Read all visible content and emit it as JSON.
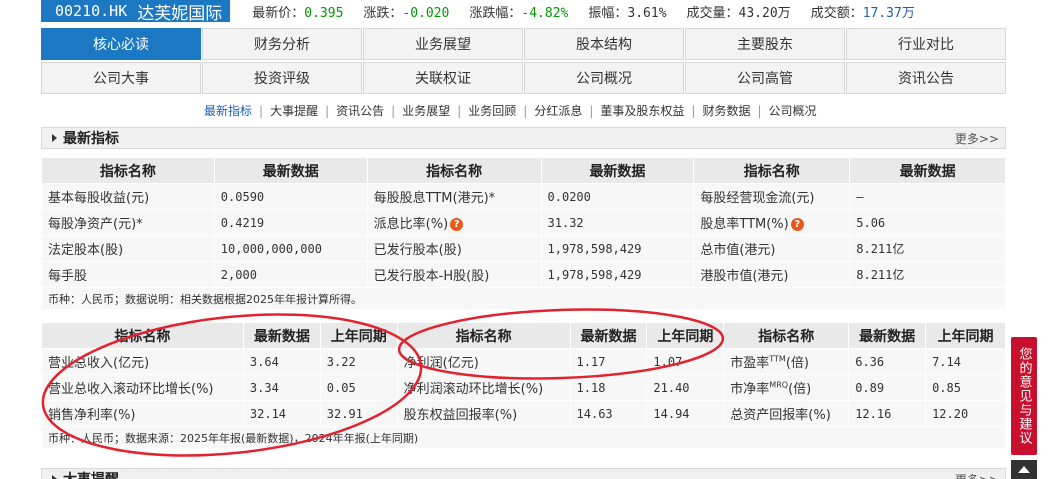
{
  "header": {
    "code": "00210.HK",
    "name": "达芙妮国际",
    "quotes": [
      {
        "label": "最新价：",
        "value": "0.395",
        "color": "#009900"
      },
      {
        "label": "涨跌：",
        "value": "-0.020",
        "color": "#009900"
      },
      {
        "label": "涨跌幅：",
        "value": "-4.82%",
        "color": "#009900"
      },
      {
        "label": "振幅：",
        "value": "3.61%",
        "color": "#333333"
      },
      {
        "label": "成交量：",
        "value": "43.20万",
        "color": "#333333"
      },
      {
        "label": "成交额：",
        "value": "17.37万",
        "color": "#1c5fb0"
      }
    ]
  },
  "tabs": [
    {
      "label": "核心必读",
      "active": true
    },
    {
      "label": "财务分析"
    },
    {
      "label": "业务展望"
    },
    {
      "label": "股本结构"
    },
    {
      "label": "主要股东"
    },
    {
      "label": "行业对比"
    },
    {
      "label": "公司大事"
    },
    {
      "label": "投资评级"
    },
    {
      "label": "关联权证"
    },
    {
      "label": "公司概况"
    },
    {
      "label": "公司高管"
    },
    {
      "label": "资讯公告"
    }
  ],
  "subnav": [
    "最新指标",
    "大事提醒",
    "资讯公告",
    "业务展望",
    "业务回顾",
    "分红派息",
    "董事及股东权益",
    "财务数据",
    "公司概况"
  ],
  "section1": {
    "title": "最新指标",
    "more": "更多>>"
  },
  "table1": {
    "headers": [
      "指标名称",
      "最新数据",
      "指标名称",
      "最新数据",
      "指标名称",
      "最新数据"
    ],
    "rows": [
      [
        "基本每股收益(元)",
        "0.0590",
        "每股股息TTM(港元)*",
        "0.0200",
        "每股经营现金流(元)",
        "—"
      ],
      [
        "每股净资产(元)*",
        "0.4219",
        "派息比率(%)",
        "31.32",
        "股息率TTM(%)",
        "5.06"
      ],
      [
        "法定股本(股)",
        "10,000,000,000",
        "已发行股本(股)",
        "1,978,598,429",
        "总市值(港元)",
        "8.211亿"
      ],
      [
        "每手股",
        "2,000",
        "已发行股本-H股(股)",
        "1,978,598,429",
        "港股市值(港元)",
        "8.211亿"
      ]
    ],
    "note": "币种：人民币；数据说明：相关数据根据2025年年报计算所得。"
  },
  "table2": {
    "headers": [
      "指标名称",
      "最新数据",
      "上年同期",
      "指标名称",
      "最新数据",
      "上年同期",
      "指标名称",
      "最新数据",
      "上年同期"
    ],
    "rows": [
      [
        "营业总收入(亿元)",
        "3.64",
        "3.22",
        "净利润(亿元)",
        "1.17",
        "1.07",
        "市盈率",
        "6.36",
        "7.14"
      ],
      [
        "营业总收入滚动环比增长(%)",
        "3.34",
        "0.05",
        "净利润滚动环比增长(%)",
        "1.18",
        "21.40",
        "市净率",
        "0.89",
        "0.85"
      ],
      [
        "销售净利率(%)",
        "32.14",
        "32.91",
        "股东权益回报率(%)",
        "14.63",
        "14.94",
        "总资产回报率(%)",
        "12.16",
        "12.20"
      ]
    ],
    "pe_sup": "TTM",
    "pe_unit": "(倍)",
    "pb_sup": "MRQ",
    "pb_unit": "(倍)",
    "note": "币种：人民币；数据来源：2025年年报(最新数据)，2024年年报(上年同期)"
  },
  "section2": {
    "title": "大事提醒",
    "more": "更多>>"
  },
  "feedback": "您的意见与建议",
  "qmark": "?",
  "accent": "#1c78c3",
  "annotation_color": "#e0232e"
}
